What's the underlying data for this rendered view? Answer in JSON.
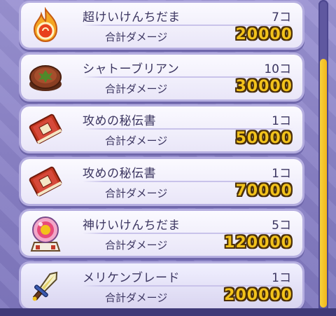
{
  "items": [
    {
      "name": "超けいけんちだま",
      "count": "7コ",
      "damage_label": "合計ダメージ",
      "damage": "20000",
      "icon": "fire-orb-icon"
    },
    {
      "name": "シャトーブリアン",
      "count": "10コ",
      "damage_label": "合計ダメージ",
      "damage": "30000",
      "icon": "steak-icon"
    },
    {
      "name": "攻めの秘伝書",
      "count": "1コ",
      "damage_label": "合計ダメージ",
      "damage": "50000",
      "icon": "scroll-book-icon"
    },
    {
      "name": "攻めの秘伝書",
      "count": "1コ",
      "damage_label": "合計ダメージ",
      "damage": "70000",
      "icon": "scroll-book-icon"
    },
    {
      "name": "神けいけんちだま",
      "count": "5コ",
      "damage_label": "合計ダメージ",
      "damage": "120000",
      "icon": "crystal-orb-icon"
    },
    {
      "name": "メリケンブレード",
      "count": "1コ",
      "damage_label": "合計ダメージ",
      "damage": "200000",
      "icon": "blade-icon"
    }
  ],
  "colors": {
    "damage_value": "#f2c21b",
    "damage_outline": "#4a2f0a",
    "scrollbar_thumb": "#f2b71a",
    "background": "#8c84c8"
  }
}
